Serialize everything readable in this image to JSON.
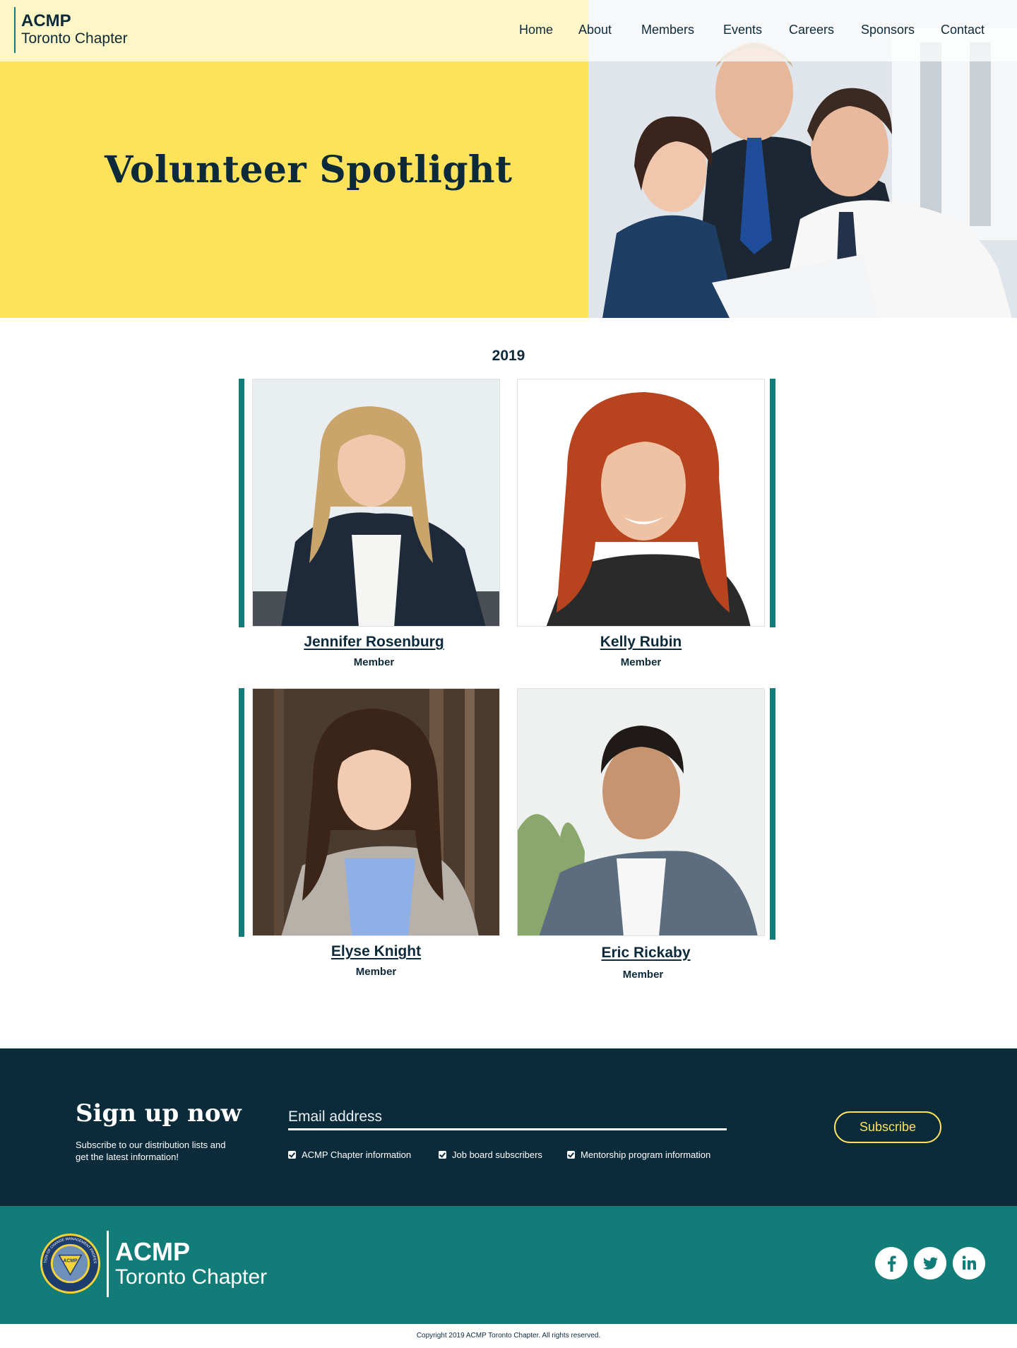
{
  "header": {
    "logo_top": "ACMP",
    "logo_bottom": "Toronto Chapter",
    "nav": [
      "Home",
      "About",
      "Members",
      "Events",
      "Careers",
      "Sponsors",
      "Contact"
    ]
  },
  "hero": {
    "title": "Volunteer Spotlight"
  },
  "spotlight": {
    "year": "2019",
    "members": [
      {
        "name": "Jennifer Rosenburg",
        "role": "Member"
      },
      {
        "name": "Kelly Rubin",
        "role": "Member"
      },
      {
        "name": "Elyse Knight",
        "role": "Member"
      },
      {
        "name": "Eric Rickaby",
        "role": "Member"
      }
    ]
  },
  "signup": {
    "title": "Sign up now",
    "subtitle": "Subscribe to our distribution lists and get the latest information!",
    "email_placeholder": "Email address",
    "options": [
      "ACMP Chapter information",
      "Job board subscribers",
      "Mentorship program information"
    ],
    "subscribe_label": "Subscribe"
  },
  "footer": {
    "logo_top": "ACMP",
    "logo_bottom": "Toronto Chapter",
    "seal_text": "ASSOCIATION OF CHANGE MANAGEMENT PROFESSIONALS",
    "seal_center": "ACMP",
    "social": [
      "facebook-icon",
      "twitter-icon",
      "linkedin-icon"
    ],
    "copyright": "Copyright 2019 ACMP Toronto Chapter. All rights reserved."
  },
  "colors": {
    "yellow": "#fee35a",
    "navy": "#0b2b3b",
    "teal": "#127c79",
    "text": "#0d2a3a"
  }
}
